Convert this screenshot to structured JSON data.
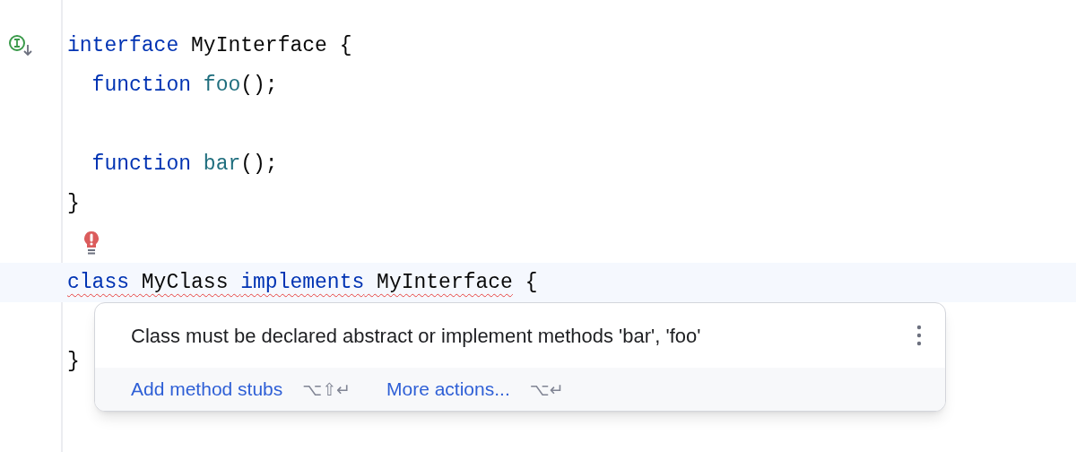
{
  "editor": {
    "lines": [
      {
        "kind": "marked",
        "current": false,
        "tokens": [
          {
            "text": "interface",
            "kind": "keyword",
            "error": false
          },
          {
            "text": " MyInterface {",
            "kind": "plain",
            "error": false
          }
        ]
      },
      {
        "kind": "code",
        "current": false,
        "tokens": [
          {
            "text": "  function",
            "kind": "keyword",
            "error": false
          },
          {
            "text": " foo",
            "kind": "function",
            "error": false
          },
          {
            "text": "();",
            "kind": "plain",
            "error": false
          }
        ]
      },
      {
        "kind": "blank",
        "current": false
      },
      {
        "kind": "code",
        "current": false,
        "tokens": [
          {
            "text": "  function",
            "kind": "keyword",
            "error": false
          },
          {
            "text": " bar",
            "kind": "function",
            "error": false
          },
          {
            "text": "();",
            "kind": "plain",
            "error": false
          }
        ]
      },
      {
        "kind": "code",
        "current": false,
        "tokens": [
          {
            "text": "}",
            "kind": "plain",
            "error": false
          }
        ]
      },
      {
        "kind": "bulb",
        "current": false
      },
      {
        "kind": "code",
        "current": true,
        "tokens": [
          {
            "text": "class",
            "kind": "keyword",
            "error": true
          },
          {
            "text": " MyClass ",
            "kind": "plain",
            "error": true
          },
          {
            "text": "implements",
            "kind": "keyword",
            "error": true
          },
          {
            "text": " MyInterface",
            "kind": "plain",
            "error": true
          },
          {
            "text": " {",
            "kind": "plain",
            "error": false
          }
        ]
      },
      {
        "kind": "blank",
        "current": false
      },
      {
        "kind": "code",
        "current": false,
        "tokens": [
          {
            "text": "}",
            "kind": "plain",
            "error": false
          }
        ]
      }
    ]
  },
  "popup": {
    "message": "Class must be declared abstract or implement methods 'bar', 'foo'",
    "actions": [
      {
        "label": "Add method stubs",
        "shortcut": "⌥⇧↵"
      },
      {
        "label": "More actions...",
        "shortcut": "⌥↵"
      }
    ]
  }
}
